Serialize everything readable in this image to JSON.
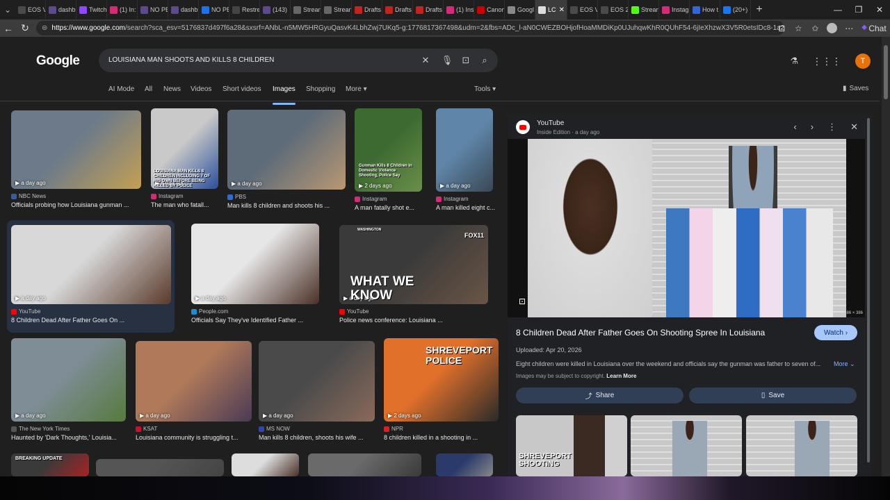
{
  "browser": {
    "tabs": [
      {
        "label": "EOS V",
        "color": "#4a4a4a"
      },
      {
        "label": "dashb",
        "color": "#5c4a8a"
      },
      {
        "label": "Twitch",
        "color": "#9146ff"
      },
      {
        "label": "(1) In:",
        "color": "#d62976"
      },
      {
        "label": "NO PE",
        "color": "#5c4a8a"
      },
      {
        "label": "dashb",
        "color": "#5c4a8a"
      },
      {
        "label": "NO PE",
        "color": "#1a73e8"
      },
      {
        "label": "Restre",
        "color": "#444444"
      },
      {
        "label": "(143)",
        "color": "#5c4a8a"
      },
      {
        "label": "Strean",
        "color": "#666666"
      },
      {
        "label": "Strean",
        "color": "#666666"
      },
      {
        "label": "Drafts",
        "color": "#c5221f"
      },
      {
        "label": "Drafts",
        "color": "#c5221f"
      },
      {
        "label": "Drafts",
        "color": "#c5221f"
      },
      {
        "label": "(1) Ins",
        "color": "#d62976"
      },
      {
        "label": "Canon",
        "color": "#cc0000"
      },
      {
        "label": "Googl",
        "color": "#888888"
      },
      {
        "label": "LC",
        "color": "#dddddd"
      },
      {
        "label": "EOS V",
        "color": "#4a4a4a"
      },
      {
        "label": "EOS 2",
        "color": "#4a4a4a"
      },
      {
        "label": "Strean",
        "color": "#53fc18"
      },
      {
        "label": "Instag",
        "color": "#d62976"
      },
      {
        "label": "How t",
        "color": "#3367d6"
      },
      {
        "label": "(20+)",
        "color": "#1877f2"
      }
    ],
    "active_tab_close": "✕",
    "new_tab": "+",
    "window_controls": [
      "—",
      "❐",
      "✕"
    ],
    "url_domain": "https://www.google.com",
    "url_path": "/search?sca_esv=5176837d497f6a28&sxsrf=ANbL-n5MW5HRGyuQasvK4LbhZwj7UKq5-g:1776817367498&udm=2&fbs=ADc_l-aN0CWEZBOHjofHoaMMDiKp0UJuhqwKhR0QUhF54-6jIeXhzwX3V5R0etsIDc8-1a2c7pkksHrL91h...",
    "chat_label": "Chat"
  },
  "search": {
    "logo": "Google",
    "query": "LOUISIANA MAN SHOOTS AND KILLS 8 CHILDREN",
    "avatar_initial": "T"
  },
  "nav": {
    "tabs": [
      "AI Mode",
      "All",
      "News",
      "Videos",
      "Short videos",
      "Images",
      "Shopping",
      "More"
    ],
    "active": "Images",
    "tools": "Tools",
    "saves": "Saves"
  },
  "results": [
    {
      "ago": "a day ago",
      "source": "NBC News",
      "title": "Officials probing how Louisiana gunman ...",
      "src_color": "#3b5b9a",
      "c1": "#6c7a8a",
      "c2": "#c4a052"
    },
    {
      "ago": "a day ago",
      "source": "Instagram",
      "title": "The man who fatall...",
      "src_color": "#d62976",
      "c1": "#c9c9c9",
      "c2": "#2a4f9a"
    },
    {
      "ago": "a day ago",
      "source": "PBS",
      "title": "Man kills 8 children and shoots his ...",
      "src_color": "#2d6bd4",
      "c1": "#5e6b78",
      "c2": "#b99872"
    },
    {
      "ago": "2 days ago",
      "source": "Instagram",
      "title": "A man fatally shot e...",
      "src_color": "#d62976",
      "c1": "#3d6a30",
      "c2": "#6b8f4a"
    },
    {
      "ago": "a day ago",
      "source": "Instagram",
      "title": "A man killed eight c...",
      "src_color": "#d62976",
      "c1": "#5f86a8",
      "c2": "#3a4755"
    },
    {
      "ago": "a day ago",
      "source": "YouTube",
      "title": "8 Children Dead After Father Goes On ...",
      "src_color": "#ff0000",
      "c1": "#d8d8d8",
      "c2": "#5a3a2a"
    },
    {
      "ago": "a day ago",
      "source": "People.com",
      "title": "Officials Say They've Identified Father ...",
      "src_color": "#1a8dd8",
      "c1": "#e6e6e6",
      "c2": "#4a3025"
    },
    {
      "ago": "a day ago",
      "source": "YouTube",
      "title": "Police news conference: Louisiana ...",
      "src_color": "#ff0000",
      "c1": "#3a3a3a",
      "c2": "#6a5545"
    },
    {
      "ago": "a day ago",
      "source": "The New York Times",
      "title": "Haunted by 'Dark Thoughts,' Louisia...",
      "src_color": "#555555",
      "c1": "#7f8d96",
      "c2": "#567a3e"
    },
    {
      "ago": "a day ago",
      "source": "KSAT",
      "title": "Louisiana community is struggling t...",
      "src_color": "#c8102e",
      "c1": "#b07a5a",
      "c2": "#4a3a55"
    },
    {
      "ago": "a day ago",
      "source": "MS NOW",
      "title": "Man kills 8 children, shoots his wife ...",
      "src_color": "#3344aa",
      "c1": "#4a4a4a",
      "c2": "#8a6a5a"
    },
    {
      "ago": "2 days ago",
      "source": "NPR",
      "title": "8 children killed in a shooting in ...",
      "src_color": "#d62021",
      "c1": "#e0702a",
      "c2": "#2a2a2a"
    },
    {
      "ago": "",
      "source": "",
      "title": "",
      "src_color": "#333333",
      "c1": "#3a3a3a",
      "c2": "#aa2222"
    },
    {
      "ago": "",
      "source": "",
      "title": "",
      "src_color": "#333333",
      "c1": "#555555",
      "c2": "#444444"
    },
    {
      "ago": "",
      "source": "",
      "title": "",
      "src_color": "#333333",
      "c1": "#dddddd",
      "c2": "#4a3025"
    },
    {
      "ago": "",
      "source": "",
      "title": "",
      "src_color": "#333333",
      "c1": "#6a6a6a",
      "c2": "#3a3a3a"
    },
    {
      "ago": "",
      "source": "",
      "title": "",
      "src_color": "#333333",
      "c1": "#2a3a6a",
      "c2": "#888888"
    }
  ],
  "overlay_texts": {
    "r2": "LOUISIANA MAN KILLS 8 CHILDREN INCLUDING 7 OF HIS OWN BEFORE BEING KILLED BY POLICE",
    "r4": "Gunman Kills 8 Children in Domestic Violence Shooting, Police Say",
    "r8_brand": "FOX11",
    "r8_label": "WASHINGTON",
    "r8_big": "WHAT WE KNOW",
    "r12": "SHREVEPORT POLICE",
    "r13": "BREAKING UPDATE"
  },
  "panel": {
    "source": "YouTube",
    "sub": "Inside Edition · a day ago",
    "dims": "686 × 386",
    "title": "8 Children Dead After Father Goes On Shooting Spree In Louisiana",
    "watch": "Watch",
    "uploaded": "Uploaded: Apr 20, 2026",
    "desc": "Eight children were killed in Louisiana over the weekend and officials say the gunman was father to seven of...",
    "more": "More",
    "copyright": "Images may be subject to copyright.",
    "learn_more": "Learn More",
    "share": "Share",
    "save": "Save",
    "related_overlay": "SHREVEPORT SHOOTING"
  }
}
